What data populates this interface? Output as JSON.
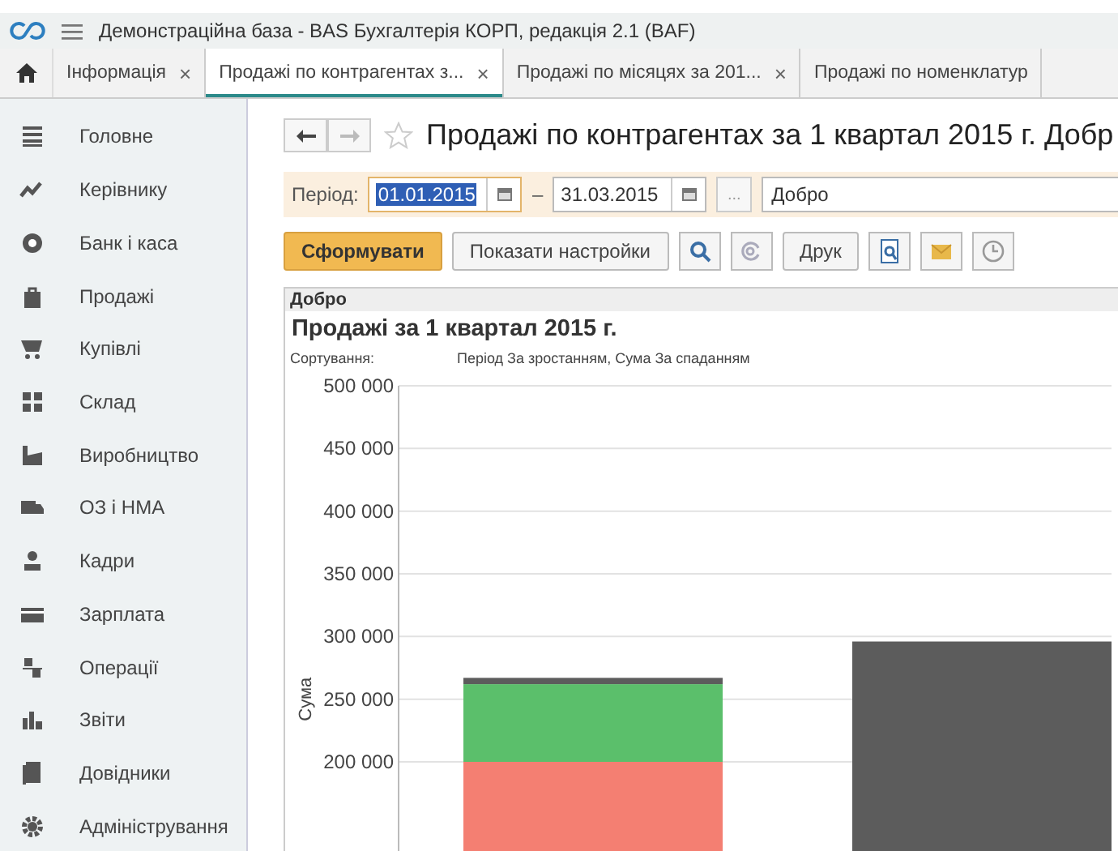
{
  "window": {
    "title": "Демонстраційна база - BAS Бухгалтерія КОРП, редакція 2.1  (BAF)"
  },
  "tabs": [
    {
      "label": "Інформація",
      "close": "×",
      "selected": false
    },
    {
      "label": "Продажі по контрагентах з...",
      "close": "×",
      "selected": true
    },
    {
      "label": "Продажі по місяцях за 201...",
      "close": "×",
      "selected": false
    },
    {
      "label": "Продажі по номенклатур",
      "selected": false
    }
  ],
  "sidebar": {
    "items": [
      {
        "label": "Головне"
      },
      {
        "label": "Керівнику"
      },
      {
        "label": "Банк і каса"
      },
      {
        "label": "Продажі"
      },
      {
        "label": "Купівлі"
      },
      {
        "label": "Склад"
      },
      {
        "label": "Виробництво"
      },
      {
        "label": "ОЗ і НМА"
      },
      {
        "label": "Кадри"
      },
      {
        "label": "Зарплата"
      },
      {
        "label": "Операції"
      },
      {
        "label": "Звіти"
      },
      {
        "label": "Довідники"
      },
      {
        "label": "Адміністрування"
      }
    ]
  },
  "report": {
    "title": "Продажі по контрагентах за 1 квартал 2015 г. Добр",
    "filter": {
      "period_label": "Період:",
      "date_from": {
        "value": "01.01.2015",
        "focused": true
      },
      "dash": "–",
      "date_to": {
        "value": "31.03.2015",
        "focused": false
      },
      "more_button": "...",
      "organization": "Добро"
    },
    "toolbar": [
      {
        "kind": "primary",
        "label": "Сформувати"
      },
      {
        "kind": "text",
        "label": "Показати настройки"
      },
      {
        "kind": "icon"
      },
      {
        "kind": "icon"
      },
      {
        "kind": "text",
        "label": "Друк"
      },
      {
        "kind": "icon"
      },
      {
        "kind": "icon"
      },
      {
        "kind": "icon"
      }
    ],
    "output": {
      "header": "Добро",
      "title": "Продажі за 1 квартал 2015 г.",
      "sort_label": "Сортування:",
      "sort_value": "Період За зростанням, Сума За спаданням",
      "chart_data": {
        "type": "bar",
        "ylabel": "Сума",
        "stacked": true,
        "grid": true,
        "ylim": [
          0,
          500000
        ],
        "series": [
          {
            "color": "#f47f72",
            "values": [
              200000,
              null
            ]
          },
          {
            "color": "#5bbf6b",
            "values": [
              62000,
              null
            ]
          },
          {
            "color": "#5c5c5c",
            "values": [
              5000,
              296000
            ]
          }
        ],
        "yticks": [
          {
            "value": 200000,
            "label": "200 000"
          },
          {
            "value": 250000,
            "label": "250 000"
          },
          {
            "value": 300000,
            "label": "300 000"
          },
          {
            "value": 350000,
            "label": "350 000"
          },
          {
            "value": 400000,
            "label": "400 000"
          },
          {
            "value": 450000,
            "label": "450 000"
          },
          {
            "value": 500000,
            "label": "500 000"
          }
        ]
      }
    }
  }
}
